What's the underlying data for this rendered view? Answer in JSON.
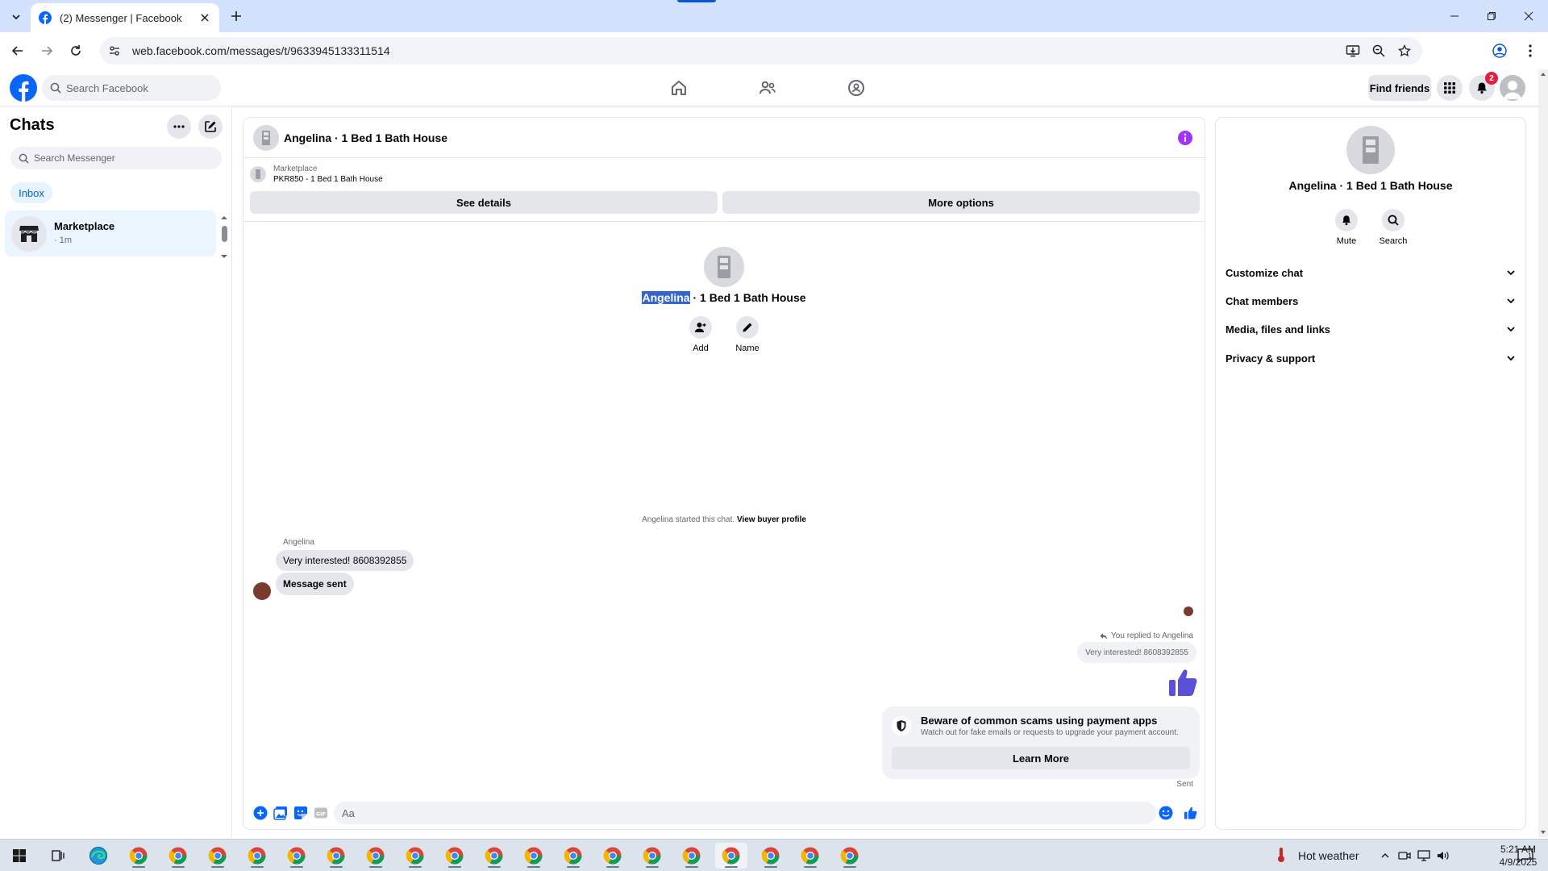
{
  "browser": {
    "tab_title": "(2) Messenger | Facebook",
    "url": "web.facebook.com/messages/t/9633945133311514"
  },
  "fb_nav": {
    "search_placeholder": "Search Facebook",
    "find_friends": "Find friends",
    "notification_count": "2"
  },
  "sidebar": {
    "title": "Chats",
    "search_placeholder": "Search Messenger",
    "filter": "Inbox",
    "chats": [
      {
        "name": "Marketplace",
        "time": "· 1m"
      }
    ]
  },
  "chat": {
    "header_title": "Angelina · 1 Bed 1 Bath House",
    "marketplace_label": "Marketplace",
    "listing": "PKR850 - 1 Bed 1 Bath House",
    "see_details": "See details",
    "more_options": "More options",
    "title_highlight": "Angelina",
    "title_rest": " · 1 Bed 1 Bath House",
    "actions": {
      "add": "Add",
      "name": "Name"
    },
    "started_text": "Angelina started this chat. ",
    "view_buyer_profile": "View buyer profile",
    "sender_name": "Angelina",
    "messages_received": [
      "Very interested! 8608392855",
      "Message sent"
    ],
    "replied_label": "You replied to Angelina",
    "replied_quote": "Very interested! 8608392855",
    "scam_title": "Beware of common scams using payment apps",
    "scam_sub": "Watch out for fake emails or requests to upgrade your payment account.",
    "learn_more": "Learn More",
    "sent_status": "Sent",
    "composer_placeholder": "Aa"
  },
  "info_panel": {
    "name": "Angelina · 1 Bed 1 Bath House",
    "mute": "Mute",
    "search": "Search",
    "sections": [
      "Customize chat",
      "Chat members",
      "Media, files and links",
      "Privacy & support"
    ]
  },
  "taskbar": {
    "weather": "Hot weather",
    "time": "5:21 AM",
    "date": "4/9/2025",
    "notification_count": "1"
  },
  "colors": {
    "fb_blue": "#0866ff",
    "like_blue": "#5b51d8",
    "info_purple": "#a033ff",
    "badge_red": "#e41e3f"
  }
}
